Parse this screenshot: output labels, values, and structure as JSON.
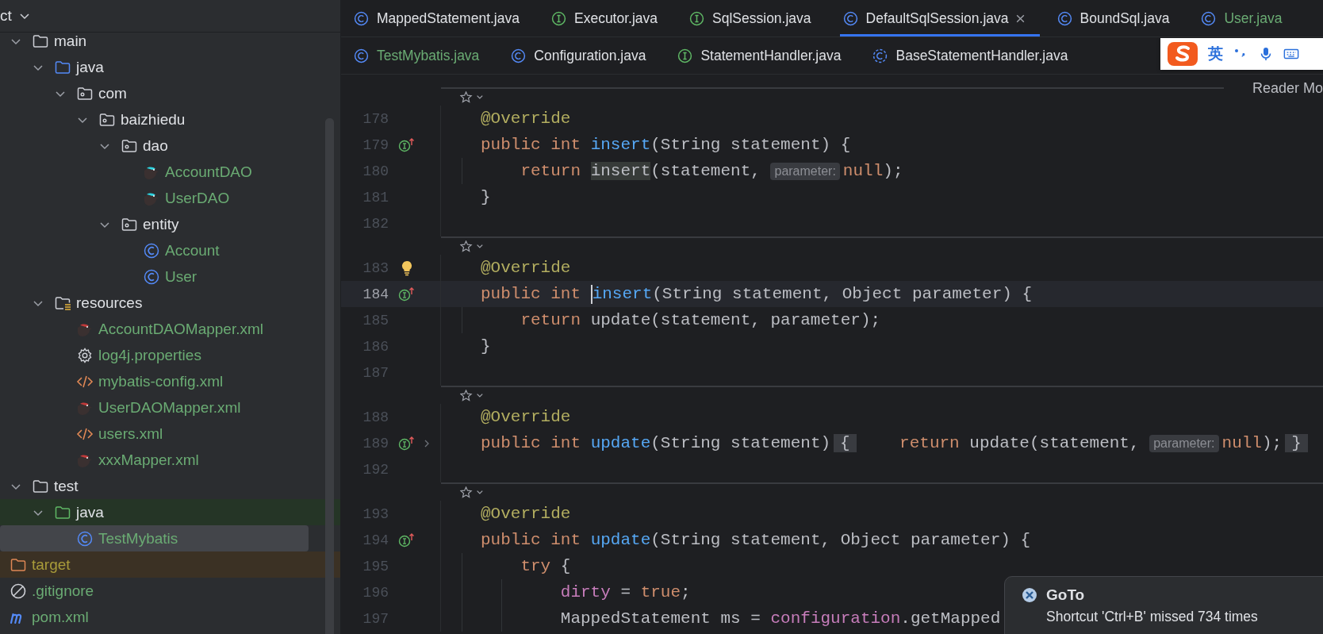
{
  "sidebar": {
    "title": "ct",
    "tree": [
      {
        "name": "main",
        "kind": "folder",
        "added": false,
        "expanded": true,
        "selected": false,
        "children": [
          {
            "name": "java",
            "kind": "source-folder",
            "added": false,
            "expanded": true,
            "selected": false,
            "children": [
              {
                "name": "com",
                "kind": "package",
                "added": false,
                "expanded": true,
                "selected": false,
                "children": [
                  {
                    "name": "baizhiedu",
                    "kind": "package",
                    "added": false,
                    "expanded": true,
                    "selected": false,
                    "children": [
                      {
                        "name": "dao",
                        "kind": "package",
                        "added": false,
                        "expanded": true,
                        "selected": false,
                        "children": [
                          {
                            "name": "AccountDAO",
                            "kind": "mapper-interface",
                            "added": true,
                            "selected": false
                          },
                          {
                            "name": "UserDAO",
                            "kind": "mapper-interface",
                            "added": true,
                            "selected": false
                          }
                        ]
                      },
                      {
                        "name": "entity",
                        "kind": "package",
                        "added": false,
                        "expanded": true,
                        "selected": false,
                        "children": [
                          {
                            "name": "Account",
                            "kind": "class",
                            "added": true,
                            "selected": false
                          },
                          {
                            "name": "User",
                            "kind": "class",
                            "added": true,
                            "selected": false
                          }
                        ]
                      }
                    ]
                  }
                ]
              }
            ]
          },
          {
            "name": "resources",
            "kind": "resources-folder",
            "added": false,
            "expanded": true,
            "selected": false,
            "children": [
              {
                "name": "AccountDAOMapper.xml",
                "kind": "mapper-xml",
                "added": true,
                "selected": false
              },
              {
                "name": "log4j.properties",
                "kind": "properties",
                "added": true,
                "selected": false
              },
              {
                "name": "mybatis-config.xml",
                "kind": "xml",
                "added": true,
                "selected": false
              },
              {
                "name": "UserDAOMapper.xml",
                "kind": "mapper-xml",
                "added": true,
                "selected": false
              },
              {
                "name": "users.xml",
                "kind": "xml",
                "added": true,
                "selected": false
              },
              {
                "name": "xxxMapper.xml",
                "kind": "mapper-xml",
                "added": true,
                "selected": false
              }
            ]
          }
        ]
      },
      {
        "name": "test",
        "kind": "folder",
        "added": false,
        "expanded": true,
        "selected": false,
        "children": [
          {
            "name": "java",
            "kind": "test-folder",
            "added": false,
            "expanded": true,
            "selected": false,
            "children": [
              {
                "name": "TestMybatis",
                "kind": "class",
                "added": true,
                "selected": true
              }
            ]
          }
        ]
      },
      {
        "name": "target",
        "kind": "excluded-folder",
        "added": false,
        "selected": false
      },
      {
        "name": ".gitignore",
        "kind": "ignore",
        "added": true,
        "selected": false
      },
      {
        "name": "pom.xml",
        "kind": "maven",
        "added": true,
        "selected": false
      }
    ]
  },
  "tab_rows": [
    {
      "tabs": [
        {
          "label": "MappedStatement.java",
          "kind": "class",
          "added": false,
          "selected": false
        },
        {
          "label": "Executor.java",
          "kind": "interface",
          "added": false,
          "selected": false
        },
        {
          "label": "SqlSession.java",
          "kind": "interface",
          "added": false,
          "selected": false
        },
        {
          "label": "DefaultSqlSession.java",
          "kind": "class",
          "added": false,
          "selected": true
        },
        {
          "label": "BoundSql.java",
          "kind": "class",
          "added": false,
          "selected": false
        },
        {
          "label": "User.java",
          "kind": "class",
          "added": true,
          "selected": false
        }
      ]
    },
    {
      "tabs": [
        {
          "label": "TestMybatis.java",
          "kind": "class",
          "added": true,
          "selected": false
        },
        {
          "label": "Configuration.java",
          "kind": "class",
          "added": false,
          "selected": false
        },
        {
          "label": "StatementHandler.java",
          "kind": "interface",
          "added": false,
          "selected": false
        },
        {
          "label": "BaseStatementHandler.java",
          "kind": "abstract",
          "added": false,
          "selected": false
        }
      ]
    }
  ],
  "ime_toolbar": {
    "language": "英"
  },
  "editor": {
    "reader_mode": "Reader Mo",
    "rows": [
      {
        "kind": "separator"
      },
      {
        "kind": "code",
        "number": "178",
        "tokens": [
          {
            "text": "@Override",
            "kind": "annotation"
          }
        ]
      },
      {
        "kind": "code",
        "number": "179",
        "gutter": {
          "kind": "implements"
        },
        "tokens": [
          {
            "text": "public int ",
            "kind": "keyword"
          },
          {
            "text": "insert",
            "kind": "declaration"
          },
          {
            "text": "(String statement) {",
            "kind": "plain"
          }
        ]
      },
      {
        "kind": "code",
        "number": "180",
        "tokens": [
          {
            "text": "    return ",
            "kind": "keyword"
          },
          {
            "text": "insert",
            "kind": "usage"
          },
          {
            "text": "(statement, ",
            "kind": "plain"
          },
          {
            "text": "parameter:",
            "kind": "hint"
          },
          {
            "text": "null",
            "kind": "keyword"
          },
          {
            "text": ");",
            "kind": "plain"
          }
        ]
      },
      {
        "kind": "code",
        "number": "181",
        "tokens": [
          {
            "text": "}",
            "kind": "plain"
          }
        ]
      },
      {
        "kind": "code",
        "number": "182"
      },
      {
        "kind": "separator"
      },
      {
        "kind": "code",
        "number": "183",
        "gutter": {
          "kind": "bulb"
        },
        "tokens": [
          {
            "text": "@Override",
            "kind": "annotation"
          }
        ]
      },
      {
        "kind": "code",
        "number": "184",
        "gutter": {
          "kind": "implements"
        },
        "current": true,
        "tokens": [
          {
            "text": "public int ",
            "kind": "keyword"
          },
          {
            "text": "insert",
            "kind": "declaration",
            "caret": true
          },
          {
            "text": "(String statement, Object parameter) {",
            "kind": "plain"
          }
        ]
      },
      {
        "kind": "code",
        "number": "185",
        "tokens": [
          {
            "text": "    return ",
            "kind": "keyword"
          },
          {
            "text": "update(statement, parameter);",
            "kind": "plain"
          }
        ]
      },
      {
        "kind": "code",
        "number": "186",
        "tokens": [
          {
            "text": "}",
            "kind": "plain"
          }
        ]
      },
      {
        "kind": "code",
        "number": "187"
      },
      {
        "kind": "separator"
      },
      {
        "kind": "code",
        "number": "188",
        "tokens": [
          {
            "text": "@Override",
            "kind": "annotation"
          }
        ]
      },
      {
        "kind": "code",
        "number": "189",
        "gutter": {
          "kind": "implements"
        },
        "folded": true,
        "tokens": [
          {
            "text": "public int ",
            "kind": "keyword"
          },
          {
            "text": "update",
            "kind": "declaration"
          },
          {
            "text": "(String statement)",
            "kind": "plain"
          },
          {
            "text": "{",
            "kind": "fold"
          },
          {
            "text": "    return ",
            "kind": "keyword"
          },
          {
            "text": "update(statement, ",
            "kind": "plain"
          },
          {
            "text": "parameter:",
            "kind": "hint"
          },
          {
            "text": "null",
            "kind": "keyword"
          },
          {
            "text": ");",
            "kind": "plain"
          },
          {
            "text": "}",
            "kind": "fold"
          }
        ]
      },
      {
        "kind": "code",
        "number": "192"
      },
      {
        "kind": "separator"
      },
      {
        "kind": "code",
        "number": "193",
        "tokens": [
          {
            "text": "@Override",
            "kind": "annotation"
          }
        ]
      },
      {
        "kind": "code",
        "number": "194",
        "gutter": {
          "kind": "implements"
        },
        "tokens": [
          {
            "text": "public int ",
            "kind": "keyword"
          },
          {
            "text": "update",
            "kind": "declaration"
          },
          {
            "text": "(String statement, Object parameter) {",
            "kind": "plain"
          }
        ]
      },
      {
        "kind": "code",
        "number": "195",
        "tokens": [
          {
            "text": "    try ",
            "kind": "keyword"
          },
          {
            "text": "{",
            "kind": "plain"
          }
        ]
      },
      {
        "kind": "code",
        "number": "196",
        "tokens": [
          {
            "text": "        dirty",
            "kind": "field"
          },
          {
            "text": " = ",
            "kind": "plain"
          },
          {
            "text": "true",
            "kind": "keyword"
          },
          {
            "text": ";",
            "kind": "plain"
          }
        ]
      },
      {
        "kind": "code",
        "number": "197",
        "tokens": [
          {
            "text": "        MappedStatement ms = ",
            "kind": "plain"
          },
          {
            "text": "configuration",
            "kind": "field"
          },
          {
            "text": ".getMapped",
            "kind": "plain"
          }
        ]
      }
    ]
  },
  "notification": {
    "title": "GoTo",
    "message": "Shortcut 'Ctrl+B' missed 734 times"
  }
}
